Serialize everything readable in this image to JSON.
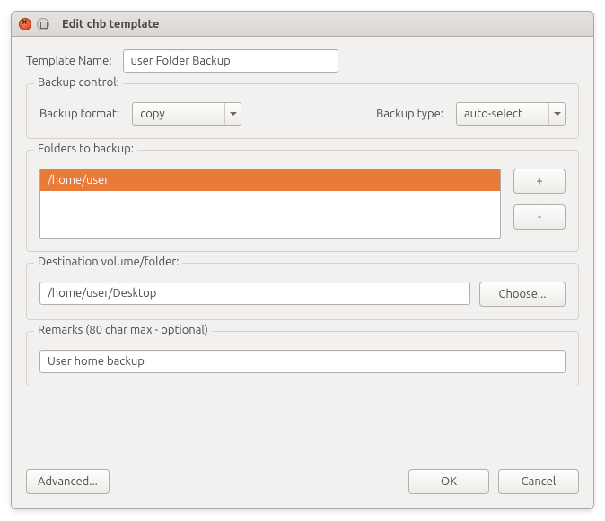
{
  "window": {
    "title": "Edit chb template"
  },
  "template_name": {
    "label": "Template Name:",
    "value": "user Folder Backup"
  },
  "backup_control": {
    "legend": "Backup control:",
    "format_label": "Backup format:",
    "format_value": "copy",
    "type_label": "Backup type:",
    "type_value": "auto-select"
  },
  "folders": {
    "legend": "Folders to backup:",
    "items": [
      "/home/user"
    ],
    "add_label": "+",
    "remove_label": "-"
  },
  "destination": {
    "legend": "Destination volume/folder:",
    "value": "/home/user/Desktop",
    "choose_label": "Choose..."
  },
  "remarks": {
    "legend": "Remarks (80 char max - optional)",
    "value": "User home backup"
  },
  "footer": {
    "advanced": "Advanced...",
    "ok": "OK",
    "cancel": "Cancel"
  }
}
